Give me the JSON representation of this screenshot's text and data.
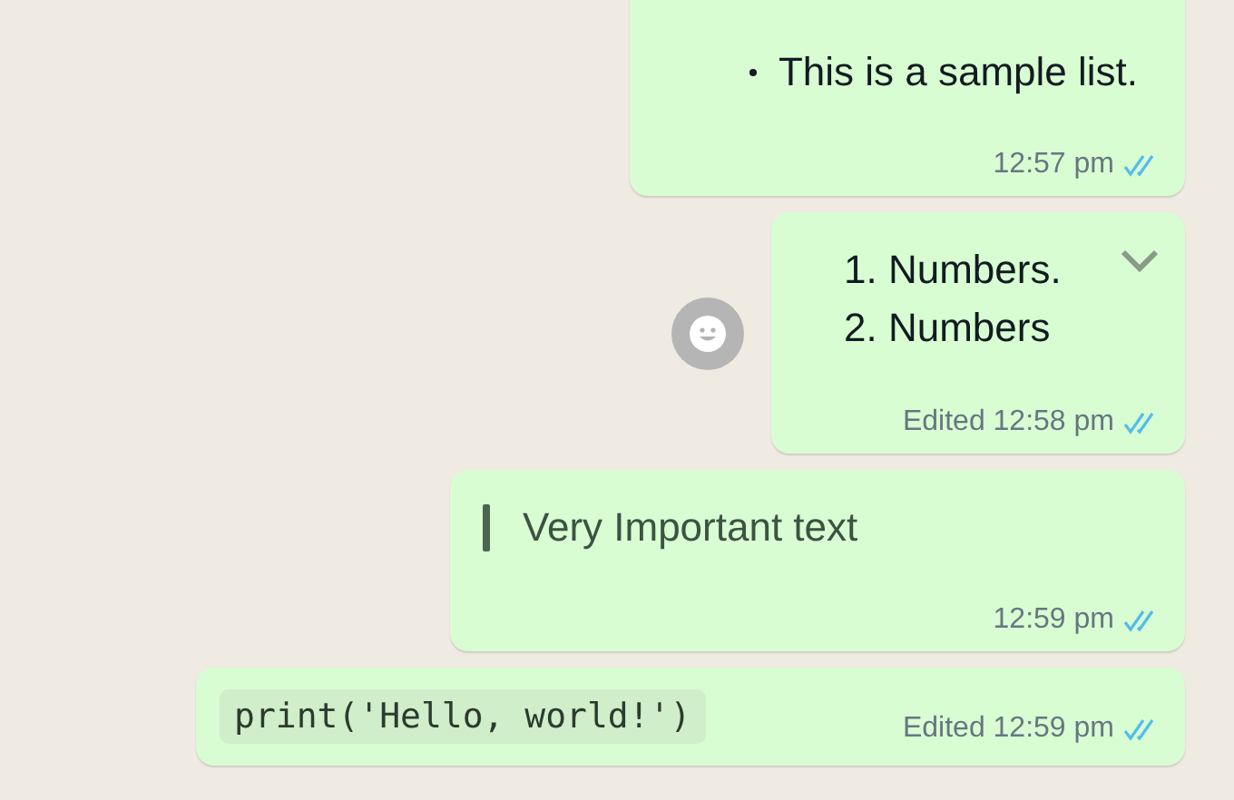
{
  "messages": [
    {
      "kind": "bullet",
      "lines": [
        "This is a sample list."
      ],
      "meta": "12:57 pm",
      "read": true,
      "hovered": false
    },
    {
      "kind": "numbered",
      "lines": [
        "1. Numbers.",
        "2. Numbers"
      ],
      "meta": "Edited 12:58 pm",
      "read": true,
      "hovered": true
    },
    {
      "kind": "quote",
      "lines": [
        "Very Important text"
      ],
      "meta": "12:59 pm",
      "read": true,
      "hovered": false
    },
    {
      "kind": "code",
      "lines": [
        "print('Hello, world!')"
      ],
      "meta": "Edited 12:59 pm",
      "read": true,
      "hovered": false
    }
  ]
}
